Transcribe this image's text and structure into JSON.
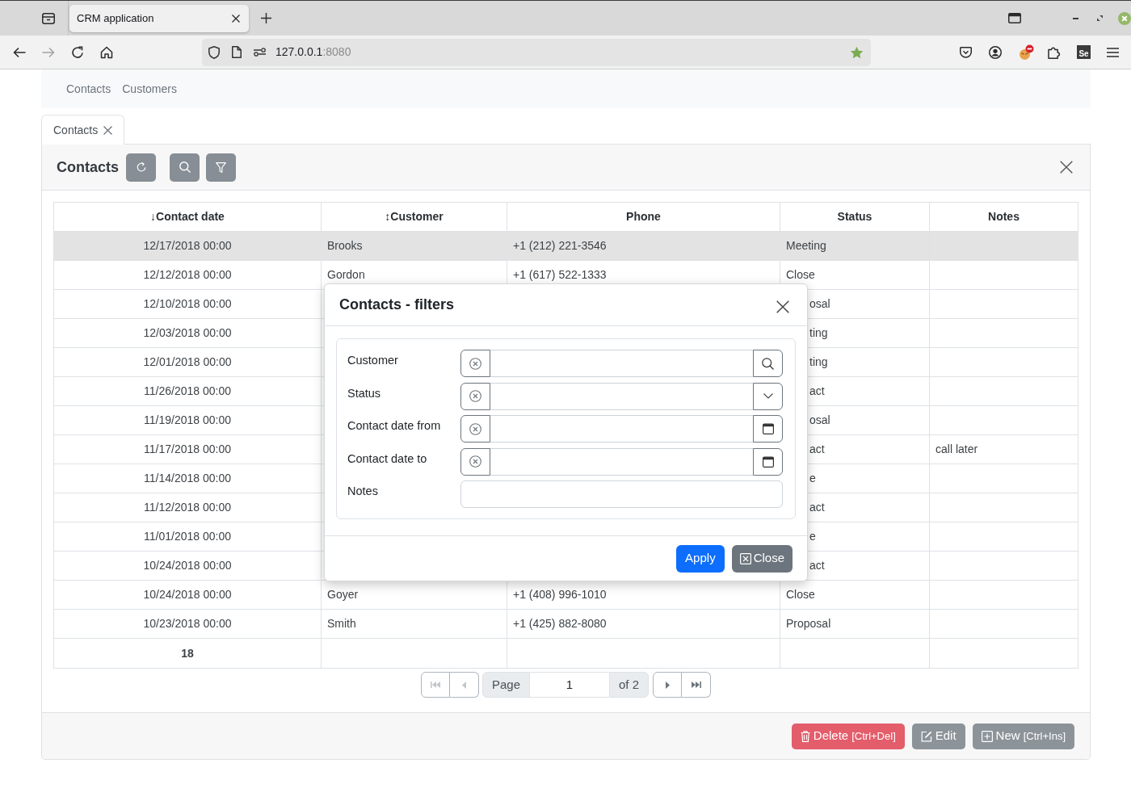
{
  "browser": {
    "tab": {
      "title": "CRM application"
    },
    "nav_buttons": [
      {
        "kind": "back",
        "disabled": false
      },
      {
        "kind": "forward",
        "disabled": true
      },
      {
        "kind": "reload",
        "disabled": false
      },
      {
        "kind": "home",
        "disabled": false
      }
    ],
    "address": {
      "host": "127.0.0.1",
      "port": ":8080",
      "bookmarked": true
    },
    "extension_label": "Se"
  },
  "nav": [
    {
      "label": "Contacts"
    },
    {
      "label": "Customers"
    }
  ],
  "tabs": [
    {
      "label": "Contacts",
      "selected": true
    }
  ],
  "panel": {
    "title": "Contacts",
    "table": {
      "columns": [
        {
          "label": "Contact date",
          "sort": "↓"
        },
        {
          "label": "Customer",
          "sort": "↕"
        },
        {
          "label": "Phone"
        },
        {
          "label": "Status"
        },
        {
          "label": "Notes"
        }
      ],
      "rows": [
        {
          "contact_date": "12/17/2018 00:00",
          "customer": "Brooks",
          "phone": "+1 (212) 221-3546",
          "status": "Meeting",
          "selected": true
        },
        {
          "contact_date": "12/12/2018 00:00",
          "customer": "Gordon",
          "phone": "+1 (617) 522-1333",
          "status": "Close",
          "selected": false
        },
        {
          "contact_date": "12/10/2018 00:00",
          "status": "osal",
          "selected": false
        },
        {
          "contact_date": "12/03/2018 00:00",
          "status": "ting",
          "selected": false
        },
        {
          "contact_date": "12/01/2018 00:00",
          "status": "ting",
          "selected": false
        },
        {
          "contact_date": "11/26/2018 00:00",
          "status": "act",
          "selected": false
        },
        {
          "contact_date": "11/19/2018 00:00",
          "status": "osal",
          "selected": false
        },
        {
          "contact_date": "11/17/2018 00:00",
          "status": "act",
          "notes": "call later",
          "selected": false
        },
        {
          "contact_date": "11/14/2018 00:00",
          "status": "e",
          "selected": false
        },
        {
          "contact_date": "11/12/2018 00:00",
          "status": "act",
          "selected": false
        },
        {
          "contact_date": "11/01/2018 00:00",
          "status": "e",
          "selected": false
        },
        {
          "contact_date": "10/24/2018 00:00",
          "status": "act",
          "selected": false
        },
        {
          "contact_date": "10/24/2018 00:00",
          "customer": "Goyer",
          "phone": "+1 (408) 996-1010",
          "status": "Close",
          "selected": false
        },
        {
          "contact_date": "10/23/2018 00:00",
          "customer": "Smith",
          "phone": "+1 (425) 882-8080",
          "status": "Proposal",
          "selected": false
        }
      ],
      "footer": [
        "18"
      ]
    },
    "pagination": {
      "buttons": [
        {
          "kind": "first",
          "disabled": true
        },
        {
          "kind": "previous",
          "disabled": true
        },
        {
          "kind": "next",
          "disabled": false
        },
        {
          "kind": "last",
          "disabled": false
        }
      ],
      "page_label": "Page",
      "page": "1",
      "of": "of 2"
    },
    "actions": [
      {
        "kind": "delete",
        "label": "Delete",
        "shortcut": "[Ctrl+Del]"
      },
      {
        "kind": "edit",
        "label": "Edit"
      },
      {
        "kind": "new",
        "label": "New",
        "shortcut": "[Ctrl+Ins]"
      }
    ]
  },
  "modal": {
    "title": "Contacts - filters",
    "fields": [
      {
        "label": "Customer",
        "kind": "lookup"
      },
      {
        "label": "Status",
        "kind": "select"
      },
      {
        "label": "Contact date from",
        "kind": "date"
      },
      {
        "label": "Contact date to",
        "kind": "date"
      },
      {
        "label": "Notes",
        "kind": "text"
      }
    ],
    "buttons": [
      {
        "kind": "apply",
        "label": "Apply"
      },
      {
        "kind": "close",
        "label": "Close"
      }
    ]
  }
}
